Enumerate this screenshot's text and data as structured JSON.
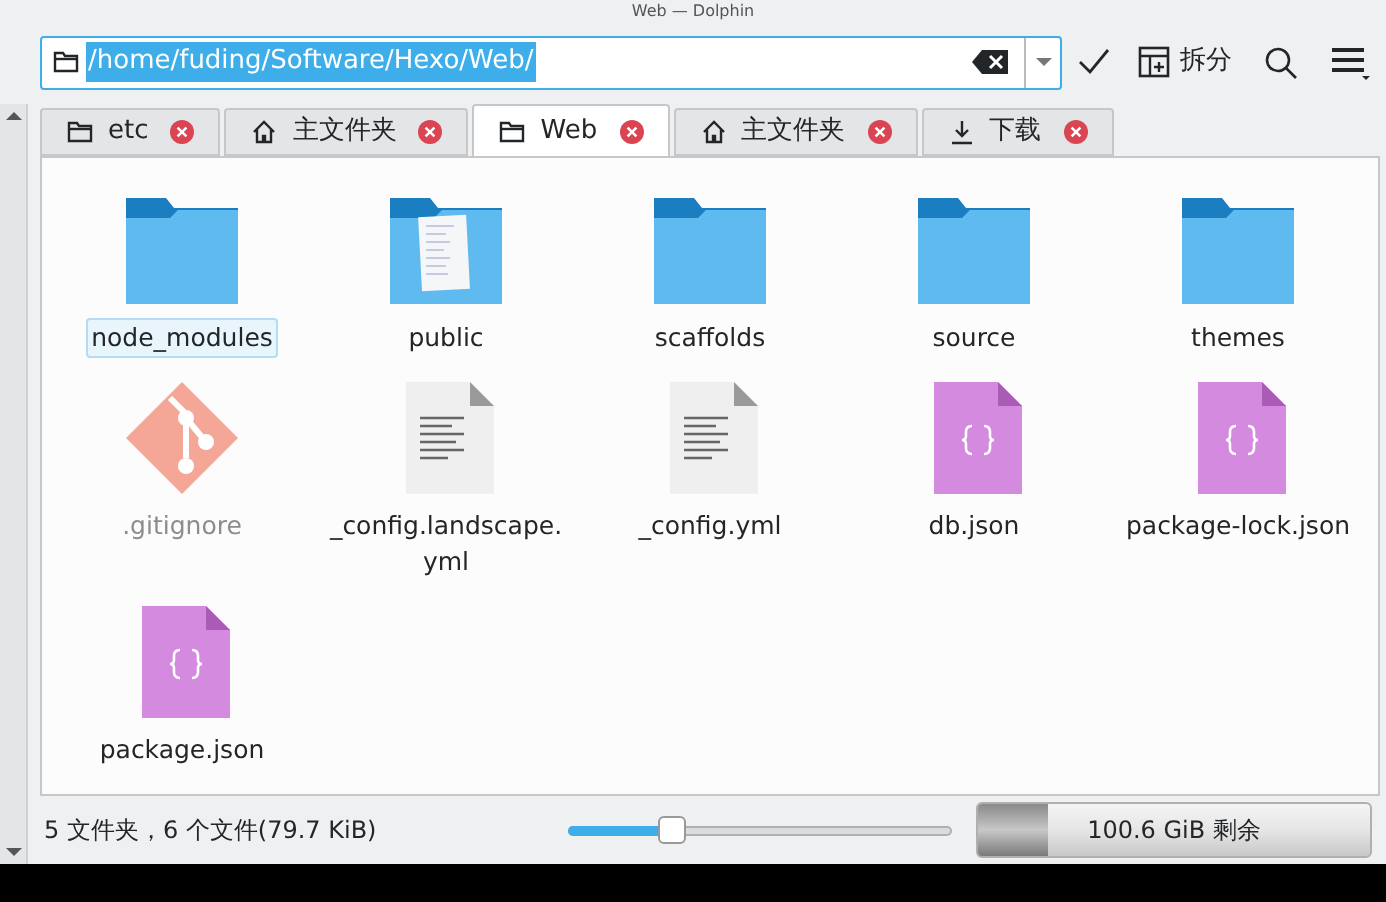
{
  "window": {
    "title": "Web — Dolphin"
  },
  "location": {
    "value": "/home/fuding/Software/Hexo/Web/"
  },
  "toolbar": {
    "split_label": "拆分"
  },
  "tabs": [
    {
      "label": "etc",
      "kind": "folder",
      "selected": false
    },
    {
      "label": "主文件夹",
      "kind": "home",
      "selected": false
    },
    {
      "label": "Web",
      "kind": "folder",
      "selected": true
    },
    {
      "label": "主文件夹",
      "kind": "home",
      "selected": false
    },
    {
      "label": "下载",
      "kind": "download",
      "selected": false
    }
  ],
  "files": [
    {
      "name": "node_modules",
      "kind": "folder",
      "selected": true,
      "hidden": false
    },
    {
      "name": "public",
      "kind": "folder-doc",
      "selected": false,
      "hidden": false
    },
    {
      "name": "scaffolds",
      "kind": "folder",
      "selected": false,
      "hidden": false
    },
    {
      "name": "source",
      "kind": "folder",
      "selected": false,
      "hidden": false
    },
    {
      "name": "themes",
      "kind": "folder",
      "selected": false,
      "hidden": false
    },
    {
      "name": ".gitignore",
      "kind": "git",
      "selected": false,
      "hidden": true
    },
    {
      "name": "_config.landscape.\nyml",
      "kind": "text",
      "selected": false,
      "hidden": false
    },
    {
      "name": "_config.yml",
      "kind": "text",
      "selected": false,
      "hidden": false
    },
    {
      "name": "db.json",
      "kind": "json",
      "selected": false,
      "hidden": false
    },
    {
      "name": "package-lock.json",
      "kind": "json",
      "selected": false,
      "hidden": false
    },
    {
      "name": "package.json",
      "kind": "json",
      "selected": false,
      "hidden": false
    }
  ],
  "status_bar": {
    "summary": "5 文件夹，6 个文件(79.7 KiB)",
    "zoom": {
      "level": 0.27
    },
    "disk": {
      "level": 0.18,
      "reading": "100.6 GiB 剩余"
    }
  }
}
